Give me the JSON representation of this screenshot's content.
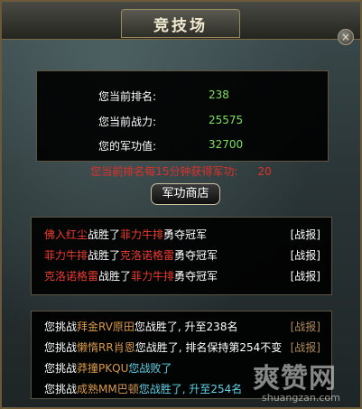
{
  "window": {
    "title": "竞技场",
    "close": "×"
  },
  "stats": [
    {
      "label": "您当前排名:",
      "value": "238"
    },
    {
      "label": "您当前战力:",
      "value": "25575"
    },
    {
      "label": "您的军功值:",
      "value": "32700"
    }
  ],
  "info": {
    "text": "您当前排名每15分钟获得军功:",
    "value": "20"
  },
  "shop_button": "军功商店",
  "top_battles": [
    {
      "winner": "佛入红尘",
      "verb": "战胜了",
      "loser": "菲力牛排",
      "suffix": "勇夺冠军",
      "report": "[战报]"
    },
    {
      "winner": "菲力牛排",
      "verb": "战胜了",
      "loser": "克洛诺格雷",
      "suffix": "勇夺冠军",
      "report": "[战报]"
    },
    {
      "winner": "克洛诺格雷",
      "verb": "战胜了",
      "loser": "菲力牛排",
      "suffix": "勇夺冠军",
      "report": "[战报]"
    }
  ],
  "my_battles": [
    {
      "prefix": "您挑战",
      "opponent": "拜金RV原田",
      "result": "您战胜了, 升至238名",
      "report": "[战报]"
    },
    {
      "prefix": "您挑战",
      "opponent": "懒惰RR肖恩",
      "result": "您战胜了, 排名保持第254不变",
      "report": "[战报]"
    },
    {
      "prefix": "您挑战",
      "opponent": "莽撞PKQU",
      "result": "您战败了",
      "report": ""
    },
    {
      "prefix": "您挑战",
      "opponent": "成熟MM巴顿",
      "result": "您战胜了, 升至254名",
      "report": ""
    }
  ],
  "watermark": {
    "main": "爽赞网",
    "sub": "shuangzan.com"
  }
}
